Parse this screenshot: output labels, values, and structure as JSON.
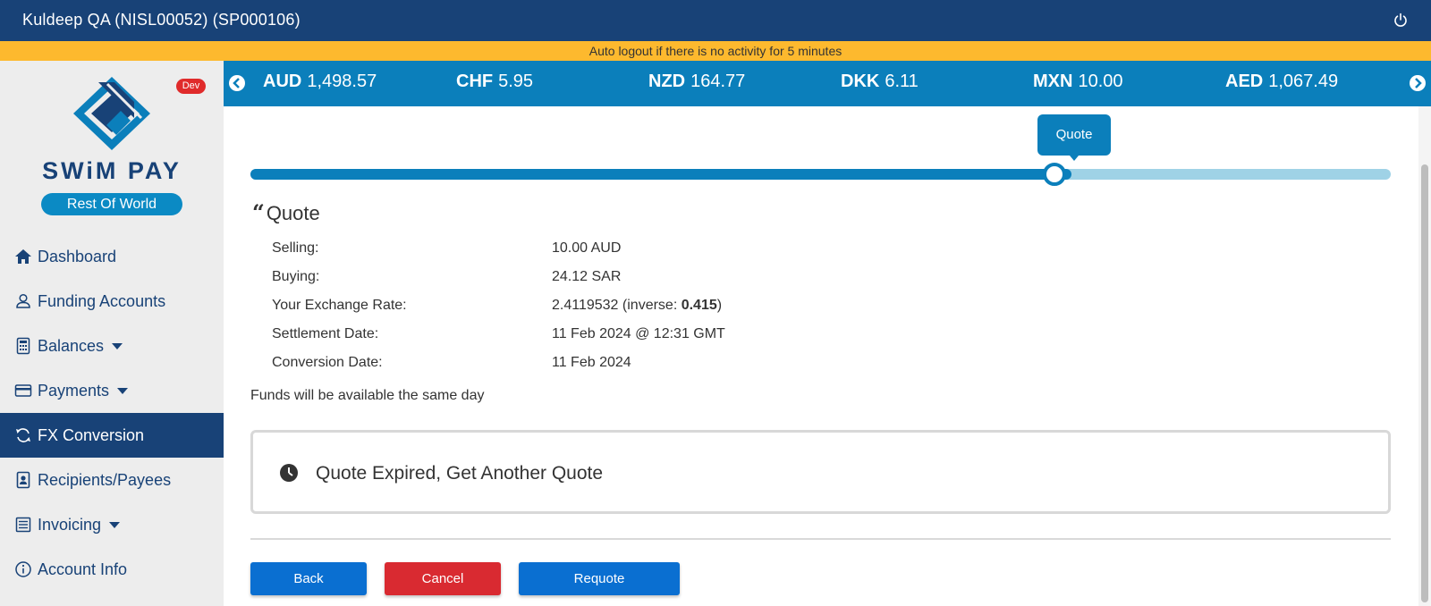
{
  "header": {
    "user_title": "Kuldeep QA (NISL00052) (SP000106)",
    "power_icon": "power-icon"
  },
  "banner": {
    "text": "Auto logout if there is no activity for 5 minutes"
  },
  "brand": {
    "env_badge": "Dev",
    "logo_text": "SWiM PAY",
    "region": "Rest Of World",
    "colors": {
      "navy": "#184277",
      "blue": "#0b7fbb",
      "accent": "#0b8ac4",
      "banner": "#fdb92e",
      "danger": "#d92a31"
    }
  },
  "sidebar": {
    "items": [
      {
        "label": "Dashboard",
        "icon": "home-icon",
        "has_caret": false,
        "active": false
      },
      {
        "label": "Funding Accounts",
        "icon": "user-icon",
        "has_caret": false,
        "active": false
      },
      {
        "label": "Balances",
        "icon": "calculator-icon",
        "has_caret": true,
        "active": false
      },
      {
        "label": "Payments",
        "icon": "credit-card-icon",
        "has_caret": true,
        "active": false
      },
      {
        "label": "FX Conversion",
        "icon": "refresh-icon",
        "has_caret": false,
        "active": true
      },
      {
        "label": "Recipients/Payees",
        "icon": "contact-card-icon",
        "has_caret": false,
        "active": false
      },
      {
        "label": "Invoicing",
        "icon": "list-icon",
        "has_caret": true,
        "active": false
      },
      {
        "label": "Account Info",
        "icon": "info-icon",
        "has_caret": false,
        "active": false
      }
    ]
  },
  "ticker": {
    "rates": [
      {
        "code": "AUD",
        "value": "1,498.57"
      },
      {
        "code": "CHF",
        "value": "5.95"
      },
      {
        "code": "NZD",
        "value": "164.77"
      },
      {
        "code": "DKK",
        "value": "6.11"
      },
      {
        "code": "MXN",
        "value": "10.00"
      },
      {
        "code": "AED",
        "value": "1,067.49"
      }
    ]
  },
  "progress": {
    "current_step_label": "Quote",
    "fraction": 0.72
  },
  "quote": {
    "title": "Quote",
    "selling_label": "Selling:",
    "selling_value": "10.00 AUD",
    "buying_label": "Buying:",
    "buying_value": "24.12 SAR",
    "rate_label": "Your Exchange Rate:",
    "rate_value": "2.4119532",
    "rate_inverse_prefix": "(inverse: ",
    "rate_inverse_value": "0.415",
    "rate_inverse_suffix": ")",
    "settlement_label": "Settlement Date:",
    "settlement_value": "11 Feb 2024 @ 12:31 GMT",
    "conversion_label": "Conversion Date:",
    "conversion_value": "11 Feb 2024",
    "funds_note": "Funds will be available the same day",
    "expired_message": "Quote Expired, Get Another Quote"
  },
  "actions": {
    "back": "Back",
    "cancel": "Cancel",
    "requote": "Requote"
  }
}
